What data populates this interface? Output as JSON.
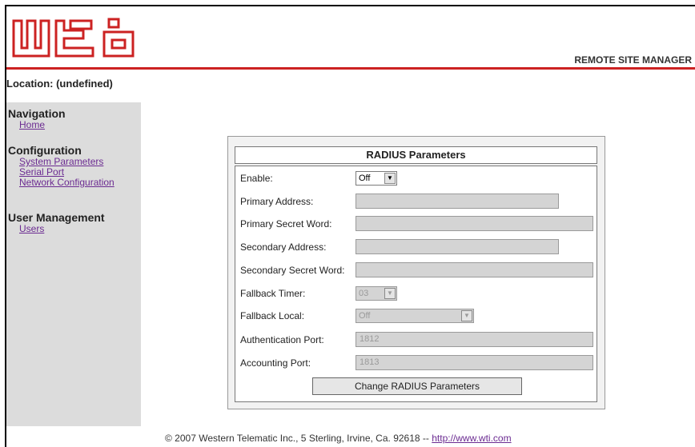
{
  "header": {
    "logo_alt": "wti",
    "tagline": "REMOTE SITE MANAGER"
  },
  "location": "Location: (undefined)",
  "sidebar": {
    "navigation": {
      "title": "Navigation",
      "items": [
        "Home"
      ]
    },
    "configuration": {
      "title": "Configuration",
      "items": [
        "System Parameters",
        "Serial Port",
        "Network Configuration"
      ]
    },
    "user_management": {
      "title": "User Management",
      "items": [
        "Users"
      ]
    }
  },
  "radius": {
    "title": "RADIUS Parameters",
    "enable_label": "Enable:",
    "enable_value": "Off",
    "primary_address_label": "Primary Address:",
    "primary_address_value": "",
    "primary_secret_label": "Primary Secret Word:",
    "primary_secret_value": "",
    "secondary_address_label": "Secondary Address:",
    "secondary_address_value": "",
    "secondary_secret_label": "Secondary Secret Word:",
    "secondary_secret_value": "",
    "fallback_timer_label": "Fallback Timer:",
    "fallback_timer_value": "03",
    "fallback_local_label": "Fallback Local:",
    "fallback_local_value": "Off",
    "auth_port_label": "Authentication Port:",
    "auth_port_value": "1812",
    "acct_port_label": "Accounting Port:",
    "acct_port_value": "1813",
    "submit_label": "Change RADIUS Parameters"
  },
  "footer": {
    "text": "© 2007 Western Telematic Inc., 5 Sterling, Irvine, Ca. 92618 -- ",
    "link": "http://www.wti.com"
  },
  "colors": {
    "accent": "#cc2222",
    "link": "#6b2b91",
    "sidebar_bg": "#dcdcdc"
  }
}
